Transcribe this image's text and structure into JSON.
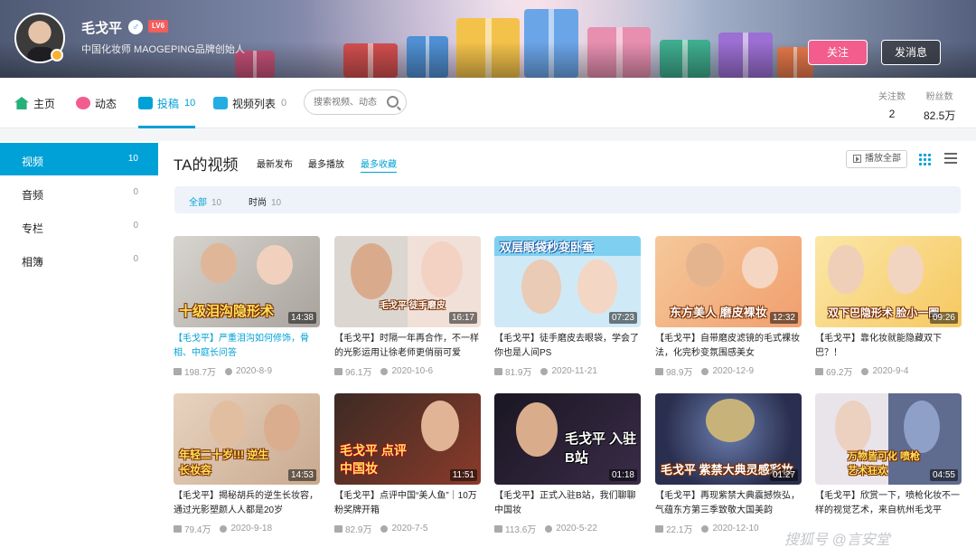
{
  "user": {
    "name": "毛戈平",
    "gender_icon": "♂",
    "level": "LV6",
    "description": "中国化妆师 MAOGEPING品牌创始人",
    "follow_label": "关注",
    "message_label": "发消息"
  },
  "nav": {
    "home": "主页",
    "dynamic": "动态",
    "posts": "投稿",
    "posts_count": "10",
    "playlist": "视频列表",
    "playlist_count": "0",
    "search_placeholder": "搜索视频、动态",
    "following_label": "关注数",
    "following_value": "2",
    "fans_label": "粉丝数",
    "fans_value": "82.5万"
  },
  "sidebar": {
    "items": [
      {
        "label": "视频",
        "count": "10"
      },
      {
        "label": "音频",
        "count": "0"
      },
      {
        "label": "专栏",
        "count": "0"
      },
      {
        "label": "相簿",
        "count": "0"
      }
    ]
  },
  "main": {
    "title": "TA的视频",
    "sort_tabs": [
      "最新发布",
      "最多播放",
      "最多收藏"
    ],
    "active_sort": "最多收藏",
    "play_all": "播放全部",
    "filters": [
      {
        "label": "全部",
        "count": "10"
      },
      {
        "label": "时尚",
        "count": "10"
      }
    ]
  },
  "videos": [
    {
      "caption": "十级泪沟隐形术",
      "duration": "14:38",
      "title": "【毛戈平】严重泪沟如何修饰，骨相、中庭长问答",
      "plays": "198.7万",
      "date": "2020-8-9"
    },
    {
      "caption": "毛戈平 徒手磨皮",
      "duration": "16:17",
      "title": "【毛戈平】时隔一年再合作，不一样的光影运用让徐老师更俏丽可爱",
      "plays": "96.1万",
      "date": "2020-10-6"
    },
    {
      "caption": "双层眼袋秒变卧蚕",
      "duration": "07:23",
      "title": "【毛戈平】徒手磨皮去眼袋，学会了你也是人间PS",
      "plays": "81.9万",
      "date": "2020-11-21"
    },
    {
      "caption": "东方美人 磨皮裸妆",
      "duration": "12:32",
      "title": "【毛戈平】自带磨皮滤镜的毛式裸妆法，化完秒变氛围感美女",
      "plays": "98.9万",
      "date": "2020-12-9"
    },
    {
      "caption": "双下巴隐形术 脸小一圈",
      "duration": "09:26",
      "title": "【毛戈平】靠化妆就能隐藏双下巴？！",
      "plays": "69.2万",
      "date": "2020-9-4"
    },
    {
      "caption": "年轻二十岁!!! 逆生长妆容",
      "duration": "14:53",
      "title": "【毛戈平】揭秘胡兵的逆生长妆容，通过光影塑颜人人都是20岁",
      "plays": "79.4万",
      "date": "2020-9-18"
    },
    {
      "caption": "毛戈平 点评 中国妆",
      "duration": "11:51",
      "title": "【毛戈平】点评中国“美人鱼”｜10万粉奖牌开箱",
      "plays": "82.9万",
      "date": "2020-7-5"
    },
    {
      "caption": "毛戈平 入驻B站",
      "duration": "01:18",
      "title": "【毛戈平】正式入驻B站，我们聊聊中国妆",
      "plays": "113.6万",
      "date": "2020-5-22"
    },
    {
      "caption": "毛戈平 紫禁大典灵感彩妆",
      "duration": "01:27",
      "title": "【毛戈平】再现紫禁大典震撼恢弘，气蕴东方第三季致敬大国美韵",
      "plays": "22.1万",
      "date": "2020-12-10"
    },
    {
      "caption": "万物皆可化 喷枪艺术狂欢",
      "duration": "04:55",
      "title": "【毛戈平】欣赏一下，喷枪化妆不一样的视觉艺术，来自杭州毛戈平",
      "plays": "",
      "date": ""
    }
  ],
  "watermark": "搜狐号 @言安堂",
  "colors": {
    "accent": "#00a1d6",
    "follow": "#f25d8e",
    "level": "#f25d5d"
  }
}
